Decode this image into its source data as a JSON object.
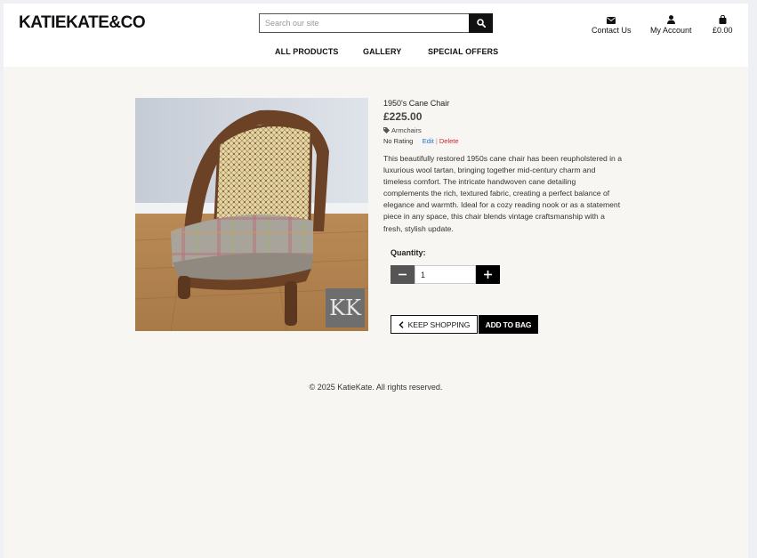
{
  "brand": "KATIEKATE&CO",
  "search": {
    "placeholder": "Search our site"
  },
  "nav": {
    "all_products": "ALL PRODUCTS",
    "gallery": "GALLERY",
    "special_offers": "SPECIAL OFFERS"
  },
  "utility": {
    "contact": "Contact Us",
    "account": "My Account",
    "bag_total": "£0.00"
  },
  "product": {
    "name": "1950's Cane Chair",
    "price": "£225.00",
    "category": "Armchairs",
    "rating": "No Rating",
    "edit": "Edit",
    "separator": "|",
    "delete": "Delete",
    "description": "This beautifully restored 1950s cane chair has been reupholstered in a luxurious wool tartan, bringing together mid-century charm and timeless comfort. The intricate handwoven cane detailing complements the rich, textured fabric, creating a perfect balance of elegance and warmth. Ideal for a cozy reading nook or as a statement piece in any space, this chair blends vintage craftsmanship with a fresh, stylish update.",
    "watermark": "KK"
  },
  "quantity": {
    "label": "Quantity:",
    "value": "1"
  },
  "buttons": {
    "keep_shopping": "KEEP SHOPPING",
    "add_to_bag": "ADD TO BAG"
  },
  "footer": "© 2025 KatieKate. All rights reserved.",
  "colors": {
    "edit_link": "#1a73c8",
    "delete_link": "#d9232d",
    "accent": "#000000"
  }
}
